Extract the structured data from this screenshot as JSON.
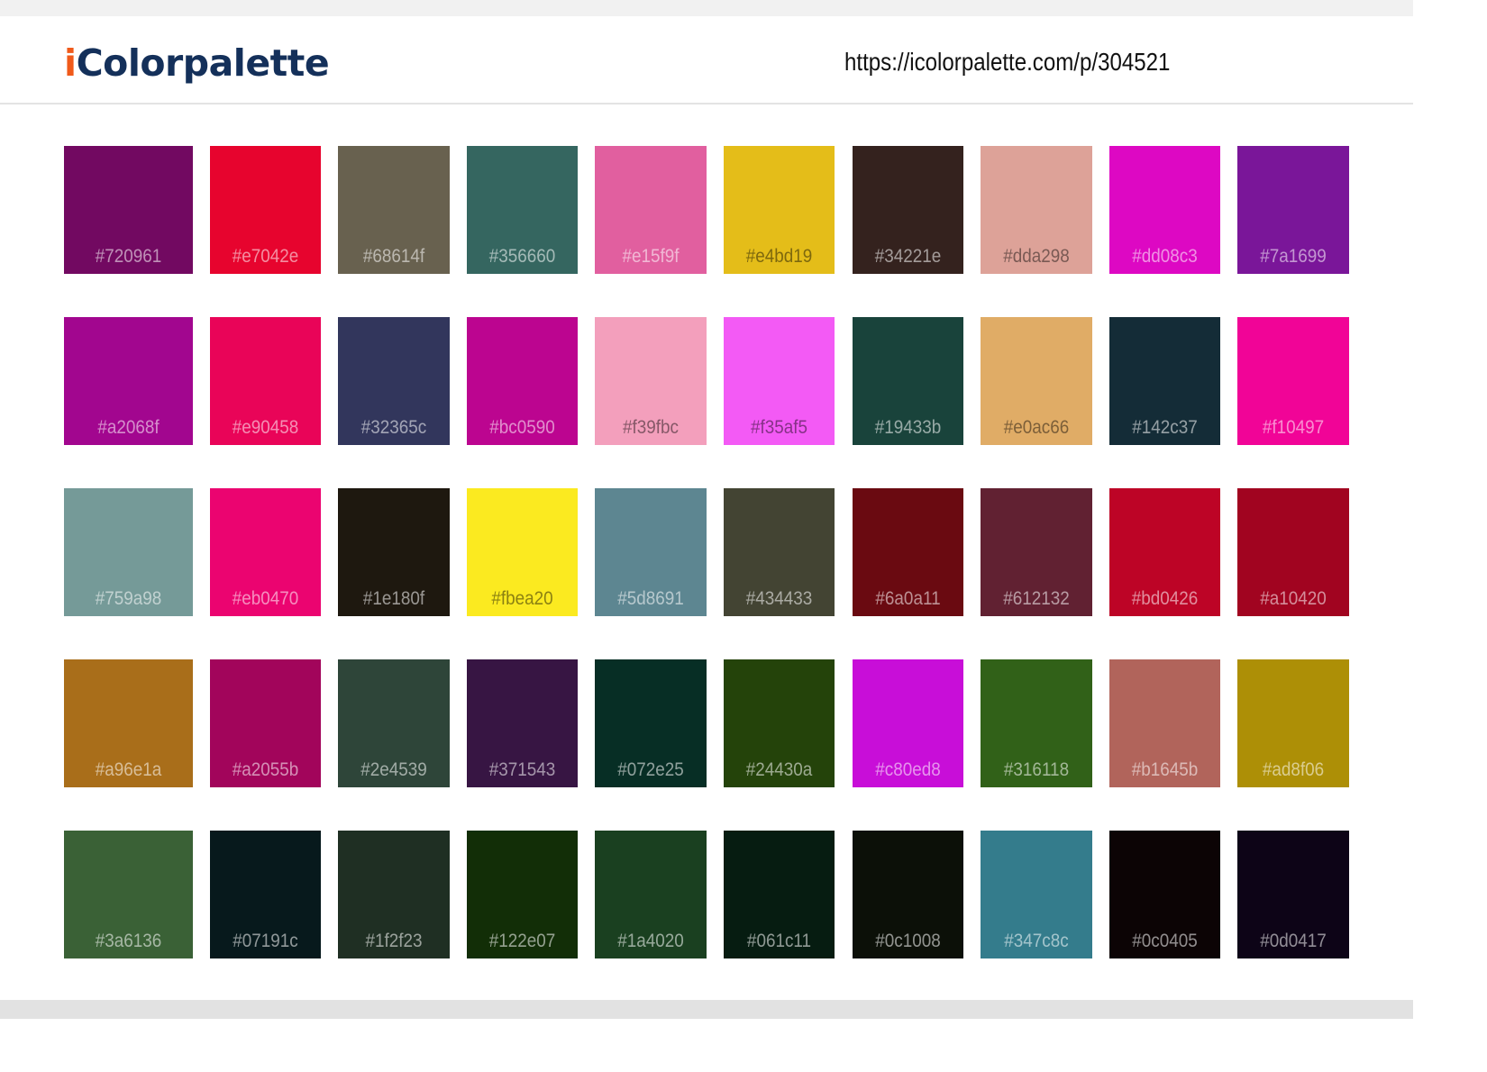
{
  "header": {
    "logo_i": "i",
    "logo_rest": "Colorpalette",
    "url": "https://icolorpalette.com/p/304521"
  },
  "colors": {
    "brand_accent": "#f05a1a",
    "brand_primary": "#14305a"
  },
  "swatches": [
    [
      "#720961",
      "#e7042e",
      "#68614f",
      "#356660",
      "#e15f9f",
      "#e4bd19",
      "#34221e",
      "#dda298",
      "#dd08c3",
      "#7a1699"
    ],
    [
      "#a2068f",
      "#e90458",
      "#32365c",
      "#bc0590",
      "#f39fbc",
      "#f35af5",
      "#19433b",
      "#e0ac66",
      "#142c37",
      "#f10497"
    ],
    [
      "#759a98",
      "#eb0470",
      "#1e180f",
      "#fbea20",
      "#5d8691",
      "#434433",
      "#6a0a11",
      "#612132",
      "#bd0426",
      "#a10420"
    ],
    [
      "#a96e1a",
      "#a2055b",
      "#2e4539",
      "#371543",
      "#072e25",
      "#24430a",
      "#c80ed8",
      "#316118",
      "#b1645b",
      "#ad8f06"
    ],
    [
      "#3a6136",
      "#07191c",
      "#1f2f23",
      "#122e07",
      "#1a4020",
      "#061c11",
      "#0c1008",
      "#347c8c",
      "#0c0405",
      "#0d0417"
    ]
  ]
}
